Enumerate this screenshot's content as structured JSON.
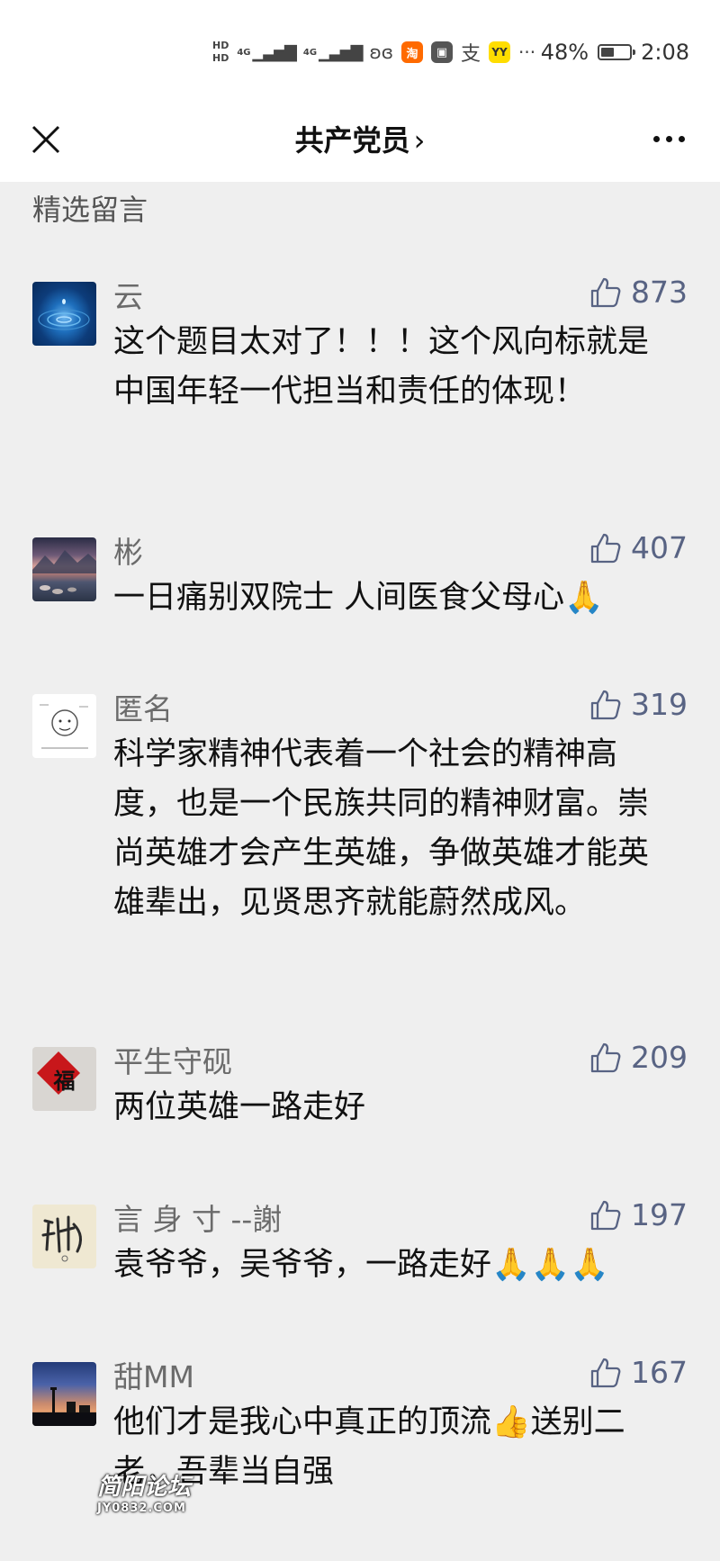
{
  "status_bar": {
    "hd1": "HD",
    "hd2": "HD",
    "net1": "4G",
    "net2": "4G",
    "app_taobao": "淘",
    "app_zhi": "支",
    "app_yy": "YY",
    "more": "···",
    "battery": "48%",
    "battery_level": 0.48,
    "time": "2:08"
  },
  "nav": {
    "title": "共产党员",
    "arrow": "›"
  },
  "section_title": "精选留言",
  "comments": [
    {
      "name": "云",
      "likes": "873",
      "text": "这个题目太对了！！！这个风向标就是中国年轻一代担当和责任的体现！"
    },
    {
      "name": "彬",
      "likes": "407",
      "text": "一日痛别双院士  人间医食父母心🙏"
    },
    {
      "name": "匿名",
      "likes": "319",
      "text": "科学家精神代表着一个社会的精神高度，也是一个民族共同的精神财富。崇尚英雄才会产生英雄，争做英雄才能英雄辈出，见贤思齐就能蔚然成风。"
    },
    {
      "name": "平生守砚",
      "likes": "209",
      "text": "两位英雄一路走好"
    },
    {
      "name": "言 身 寸 --謝",
      "likes": "197",
      "text": "袁爷爷，吴爷爷，一路走好🙏🙏🙏"
    },
    {
      "name": "甜MM",
      "likes": "167",
      "text": "他们才是我心中真正的顶流👍送别二老，吾辈当自强"
    }
  ],
  "avatars": {
    "fu_char": "福"
  },
  "watermark": {
    "line1": "简阳论坛",
    "line2": "JY0832.COM"
  },
  "colors": {
    "background": "#efefef",
    "like_color": "#586383",
    "name_color": "#6b6b6b"
  }
}
